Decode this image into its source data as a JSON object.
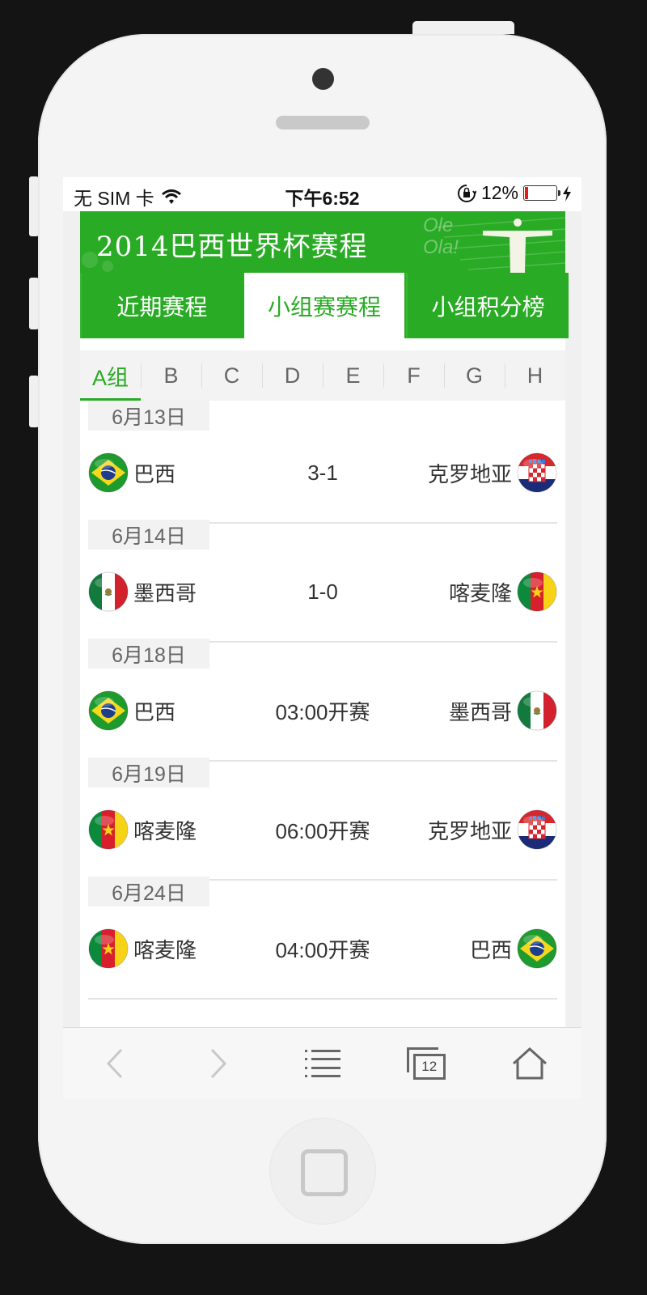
{
  "status_bar": {
    "carrier": "无 SIM 卡",
    "time": "下午6:52",
    "battery_percent": "12%",
    "battery_level": 0.12,
    "icons": [
      "wifi-icon",
      "rotation-lock-icon",
      "battery-icon",
      "charging-bolt-icon"
    ]
  },
  "banner": {
    "title": "2014巴西世界杯赛程",
    "ole_1": "Ole",
    "ole_2": "Ola!"
  },
  "tabs": [
    {
      "label": "近期赛程",
      "active": false
    },
    {
      "label": "小组赛赛程",
      "active": true
    },
    {
      "label": "小组积分榜",
      "active": false
    }
  ],
  "groups": [
    {
      "label": "A组",
      "active": true
    },
    {
      "label": "B",
      "active": false
    },
    {
      "label": "C",
      "active": false
    },
    {
      "label": "D",
      "active": false
    },
    {
      "label": "E",
      "active": false
    },
    {
      "label": "F",
      "active": false
    },
    {
      "label": "G",
      "active": false
    },
    {
      "label": "H",
      "active": false
    }
  ],
  "matches": [
    {
      "date": "6月13日",
      "home": "巴西",
      "home_flag": "brazil-flag-icon",
      "score": "3-1",
      "away": "克罗地亚",
      "away_flag": "croatia-flag-icon"
    },
    {
      "date": "6月14日",
      "home": "墨西哥",
      "home_flag": "mexico-flag-icon",
      "score": "1-0",
      "away": "喀麦隆",
      "away_flag": "cameroon-flag-icon"
    },
    {
      "date": "6月18日",
      "home": "巴西",
      "home_flag": "brazil-flag-icon",
      "score": "03:00开赛",
      "away": "墨西哥",
      "away_flag": "mexico-flag-icon"
    },
    {
      "date": "6月19日",
      "home": "喀麦隆",
      "home_flag": "cameroon-flag-icon",
      "score": "06:00开赛",
      "away": "克罗地亚",
      "away_flag": "croatia-flag-icon"
    },
    {
      "date": "6月24日",
      "home": "喀麦隆",
      "home_flag": "cameroon-flag-icon",
      "score": "04:00开赛",
      "away": "巴西",
      "away_flag": "brazil-flag-icon"
    }
  ],
  "toolbar": {
    "tabs_count": "12",
    "icons": [
      "back-arrow-icon",
      "forward-arrow-icon",
      "bookmarks-list-icon",
      "tabs-icon",
      "home-icon"
    ]
  },
  "colors": {
    "accent_green": "#2aab25",
    "phone_body": "#f4f4f4",
    "background": "#141414"
  }
}
